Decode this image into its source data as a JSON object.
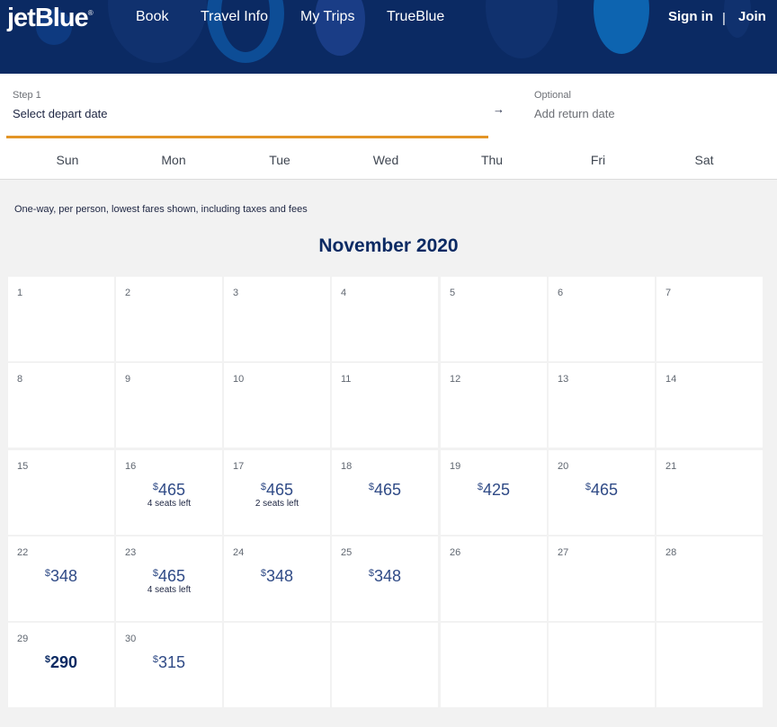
{
  "header": {
    "logo_text": "jetBlue",
    "logo_reg": "®",
    "nav": [
      "Book",
      "Travel Info",
      "My Trips",
      "TrueBlue"
    ],
    "sign_in": "Sign in",
    "separator": "|",
    "join": "Join",
    "background_color": "#0b2a63"
  },
  "steps": {
    "depart": {
      "step_label": "Step 1",
      "label": "Select depart date"
    },
    "arrow": "→",
    "return": {
      "step_label": "Optional",
      "label": "Add return date"
    },
    "active_color": "#e39526"
  },
  "weekdays": [
    "Sun",
    "Mon",
    "Tue",
    "Wed",
    "Thu",
    "Fri",
    "Sat"
  ],
  "info_text": "One-way, per person, lowest fares shown, including taxes and fees",
  "month_title": "November 2020",
  "currency_symbol": "$",
  "days": [
    {
      "day": "1"
    },
    {
      "day": "2"
    },
    {
      "day": "3"
    },
    {
      "day": "4"
    },
    {
      "day": "5"
    },
    {
      "day": "6"
    },
    {
      "day": "7"
    },
    {
      "day": "8"
    },
    {
      "day": "9"
    },
    {
      "day": "10"
    },
    {
      "day": "11"
    },
    {
      "day": "12"
    },
    {
      "day": "13"
    },
    {
      "day": "14"
    },
    {
      "day": "15"
    },
    {
      "day": "16",
      "price": "465",
      "seats": "4 seats left"
    },
    {
      "day": "17",
      "price": "465",
      "seats": "2 seats left"
    },
    {
      "day": "18",
      "price": "465"
    },
    {
      "day": "19",
      "price": "425"
    },
    {
      "day": "20",
      "price": "465"
    },
    {
      "day": "21"
    },
    {
      "day": "22",
      "price": "348"
    },
    {
      "day": "23",
      "price": "465",
      "seats": "4 seats left"
    },
    {
      "day": "24",
      "price": "348"
    },
    {
      "day": "25",
      "price": "348"
    },
    {
      "day": "26"
    },
    {
      "day": "27"
    },
    {
      "day": "28"
    },
    {
      "day": "29",
      "price": "290",
      "lowest": true
    },
    {
      "day": "30",
      "price": "315"
    },
    {
      "day": ""
    },
    {
      "day": ""
    },
    {
      "day": ""
    },
    {
      "day": ""
    },
    {
      "day": ""
    }
  ]
}
